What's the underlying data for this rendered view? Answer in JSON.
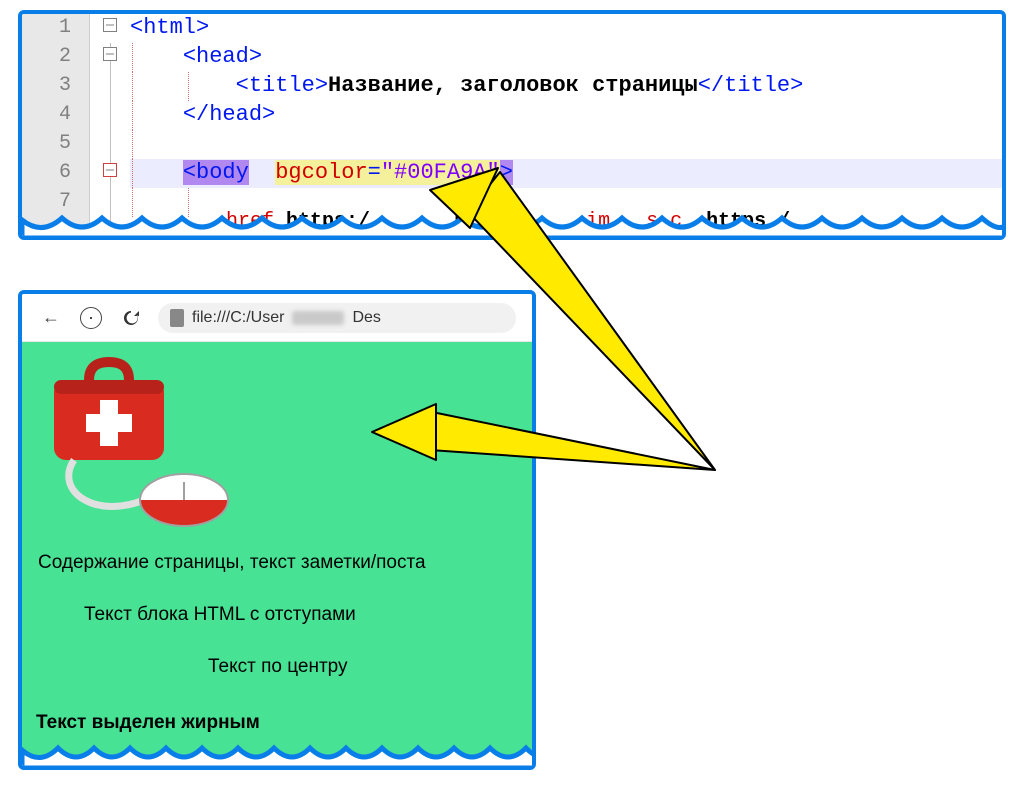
{
  "editor": {
    "lines": [
      {
        "num": "1",
        "fold": "minus"
      },
      {
        "num": "2",
        "fold": "minus"
      },
      {
        "num": "3",
        "fold": ""
      },
      {
        "num": "4",
        "fold": ""
      },
      {
        "num": "5",
        "fold": ""
      },
      {
        "num": "6",
        "fold": "minus",
        "active": true
      },
      {
        "num": "7",
        "fold": ""
      }
    ],
    "tags": {
      "html_open": "<html>",
      "head_open": "<head>",
      "title_open": "<title>",
      "title_text": "Название, заголовок страницы",
      "title_close": "</title>",
      "head_close": "</head>",
      "body_lt": "<",
      "body_name": "body",
      "body_space": "  ",
      "attr_name": "bgcolor",
      "attr_eq": "=",
      "attr_val": "\"#00FA9A\"",
      "body_gt": ">",
      "frag_href": "href",
      "frag_https": "https:/",
      "frag_p_in": "p.in",
      "frag_im": "im",
      "frag_sc": "s c",
      "frag_https2": "https /"
    }
  },
  "browser": {
    "back_arrow": "←",
    "url_pre": "file:///C:/User",
    "url_post": "Des",
    "body": {
      "p1": "Содержание страницы, текст заметки/поста",
      "p2": "Текст блока HTML с отступами",
      "p3": "Текст по центру",
      "p4": "Текст выделен жирным"
    }
  }
}
